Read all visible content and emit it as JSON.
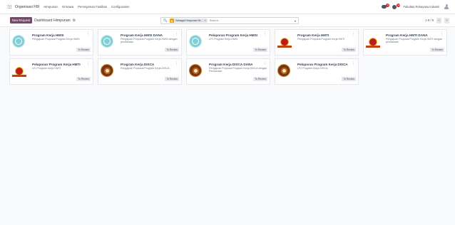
{
  "navbar": {
    "brand": "Organisasi FBI",
    "menu": [
      "Himpunan",
      "Ormawa",
      "Peminjaman Fasilitas",
      "Configuration"
    ],
    "chat_badge": "8",
    "activity_badge": "12",
    "company": "Fakultas Rekayasa Industri"
  },
  "control": {
    "new_button": "New Request",
    "title": "Dashboard Himpunan",
    "search_facet": "Sebagai Himpunan Ht...",
    "search_placeholder": "Search...",
    "pager_value": "1-9 / 9",
    "pager_prev": "<",
    "pager_next": ">"
  },
  "cards": [
    {
      "title": "Program Kerja HMSI",
      "subtitle": "Pengajuan Proposal Program Kerja HMSI",
      "status": "To Review",
      "logo": "teal"
    },
    {
      "title": "Program Kerja HMSI DANA",
      "subtitle": "Pengajuan Proposal Program Kerja HMSI dengan pendanaan",
      "status": "To Review",
      "logo": "teal"
    },
    {
      "title": "Pelaporan Program Kerja HMSI",
      "subtitle": "LPJ Program Kerja HMSI",
      "status": "To Review",
      "logo": "teal"
    },
    {
      "title": "Program Kerja HMTI",
      "subtitle": "Pengajuan Proposal Program Kerja HMTI",
      "status": "To Review",
      "logo": "flag"
    },
    {
      "title": "Program Kerja HMTI DANA",
      "subtitle": "Pengajuan Proposal Program Kerja HMTI dengan pendanaan",
      "status": "To Review",
      "logo": "flag"
    },
    {
      "title": "Pelaporan Program Kerja HMTI",
      "subtitle": "LPJ Program Kerja HMTI",
      "status": "To Review",
      "logo": "flag"
    },
    {
      "title": "Program Kerja DISCA",
      "subtitle": "Pengajuan Proposal Program Kerja DISCA",
      "status": "To Review",
      "logo": "brown"
    },
    {
      "title": "Program Kerja DISCA DANA",
      "subtitle": "Pengajuan Proposal Program Kerja DISCA dengan Pendanaan",
      "status": "To Review",
      "logo": "brown"
    },
    {
      "title": "Pelaporan Program Kerja DISCA",
      "subtitle": "LPJ Program Kerja DISCA",
      "status": "To Review",
      "logo": "brown"
    }
  ],
  "colors": {
    "accent": "#714b67",
    "facet": "#f0a500",
    "badge": "#dc2626"
  },
  "icons": [
    "apps-icon",
    "chat-icon",
    "activity-icon",
    "user-avatar-icon",
    "gear-icon",
    "search-icon",
    "filter-icon",
    "kebab-menu-icon"
  ]
}
